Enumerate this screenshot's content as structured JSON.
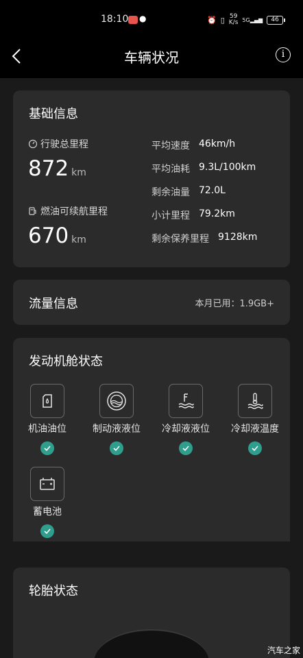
{
  "status_bar": {
    "time": "18:10",
    "network_speed_value": "59",
    "network_speed_unit": "K/s",
    "signal": "5G",
    "battery": "46",
    "icons": [
      "alarm-icon",
      "vibrate-icon",
      "signal-icon",
      "battery-icon"
    ]
  },
  "nav": {
    "title": "车辆状况",
    "info_glyph": "i"
  },
  "basic_info": {
    "title": "基础信息",
    "total_mileage_label": "行驶总里程",
    "total_mileage_value": "872",
    "total_mileage_unit": "km",
    "range_label": "燃油可续航里程",
    "range_value": "670",
    "range_unit": "km",
    "stats": [
      {
        "label": "平均速度",
        "value": "46km/h"
      },
      {
        "label": "平均油耗",
        "value": "9.3L/100km"
      },
      {
        "label": "剩余油量",
        "value": "72.0L"
      },
      {
        "label": "小计里程",
        "value": "79.2km"
      },
      {
        "label": "剩余保养里程",
        "value": "9128km"
      }
    ]
  },
  "flow_info": {
    "title": "流量信息",
    "usage": "本月已用：1.9GB+"
  },
  "engine": {
    "title": "发动机舱状态",
    "items": [
      {
        "label": "机油油位",
        "icon": "oil-can-icon",
        "status": "ok"
      },
      {
        "label": "制动液液位",
        "icon": "brake-fluid-icon",
        "status": "ok"
      },
      {
        "label": "冷却液液位",
        "icon": "coolant-level-icon",
        "status": "ok"
      },
      {
        "label": "冷却液温度",
        "icon": "coolant-temperature-icon",
        "status": "ok"
      },
      {
        "label": "蓄电池",
        "icon": "battery-icon",
        "status": "ok"
      }
    ]
  },
  "tire": {
    "title": "轮胎状态"
  },
  "watermark": "汽车之家",
  "colors": {
    "background": "#1a1a1a",
    "card": "#2b2b2b",
    "check": "#2f9e8d",
    "notification": "#e8554e"
  }
}
